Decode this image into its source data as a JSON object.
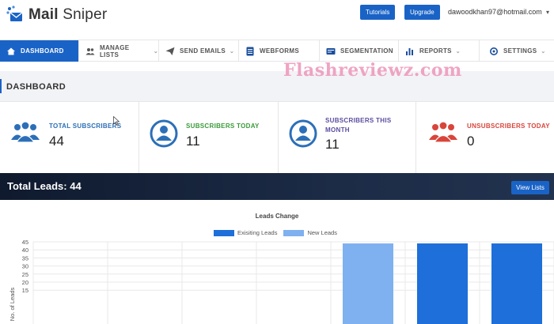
{
  "header": {
    "logo_main": "Mail",
    "logo_sub": "Sniper",
    "tutorials_label": "Tutorials",
    "upgrade_label": "Upgrade",
    "user_email": "dawoodkhan97@hotmail.com",
    "user_caret": "▾"
  },
  "nav": {
    "items": [
      {
        "label": "DASHBOARD",
        "icon": "home-icon"
      },
      {
        "label": "MANAGE LISTS",
        "icon": "users-icon",
        "caret": "⌄"
      },
      {
        "label": "SEND EMAILS",
        "icon": "paper-plane-icon",
        "caret": "⌄"
      },
      {
        "label": "WEBFORMS",
        "icon": "form-icon"
      },
      {
        "label": "SEGMENTATION",
        "icon": "segment-icon"
      },
      {
        "label": "REPORTS",
        "icon": "bar-chart-icon",
        "caret": "⌄"
      },
      {
        "label": "SETTINGS",
        "icon": "gear-icon",
        "caret": "⌄"
      }
    ]
  },
  "watermark": "Flashreviewz.com",
  "dashboard": {
    "title": "DASHBOARD",
    "stats": [
      {
        "label": "TOTAL SUBSCRIBERS",
        "value": "44",
        "color": "#2c6fb8"
      },
      {
        "label": "SUBSCRIBERS TODAY",
        "value": "11",
        "color": "#3a9a3a"
      },
      {
        "label_line1": "SUBSCRIBERS THIS",
        "label_line2": "MONTH",
        "value": "11",
        "color": "#5a4ea0"
      },
      {
        "label": "UNSUBSCRIBERS TODAY",
        "value": "0",
        "color": "#d9453b"
      }
    ]
  },
  "leads": {
    "title": "Total Leads: 44",
    "view_lists_label": "View Lists"
  },
  "chart_data": {
    "type": "bar",
    "title": "Leads Change",
    "ylabel": "No. of Leads",
    "ylim": [
      15,
      45
    ],
    "yticks": [
      15,
      20,
      25,
      30,
      35,
      40,
      45
    ],
    "categories": [
      "",
      "",
      "",
      "",
      "",
      "",
      ""
    ],
    "series": [
      {
        "name": "Exisiting Leads",
        "color": "#1e6fd9",
        "values": [
          null,
          null,
          null,
          null,
          null,
          44,
          44
        ]
      },
      {
        "name": "New Leads",
        "color": "#7fb0f0",
        "values": [
          null,
          null,
          null,
          null,
          44,
          null,
          null
        ]
      }
    ],
    "grid": true,
    "legend": "top-center"
  }
}
